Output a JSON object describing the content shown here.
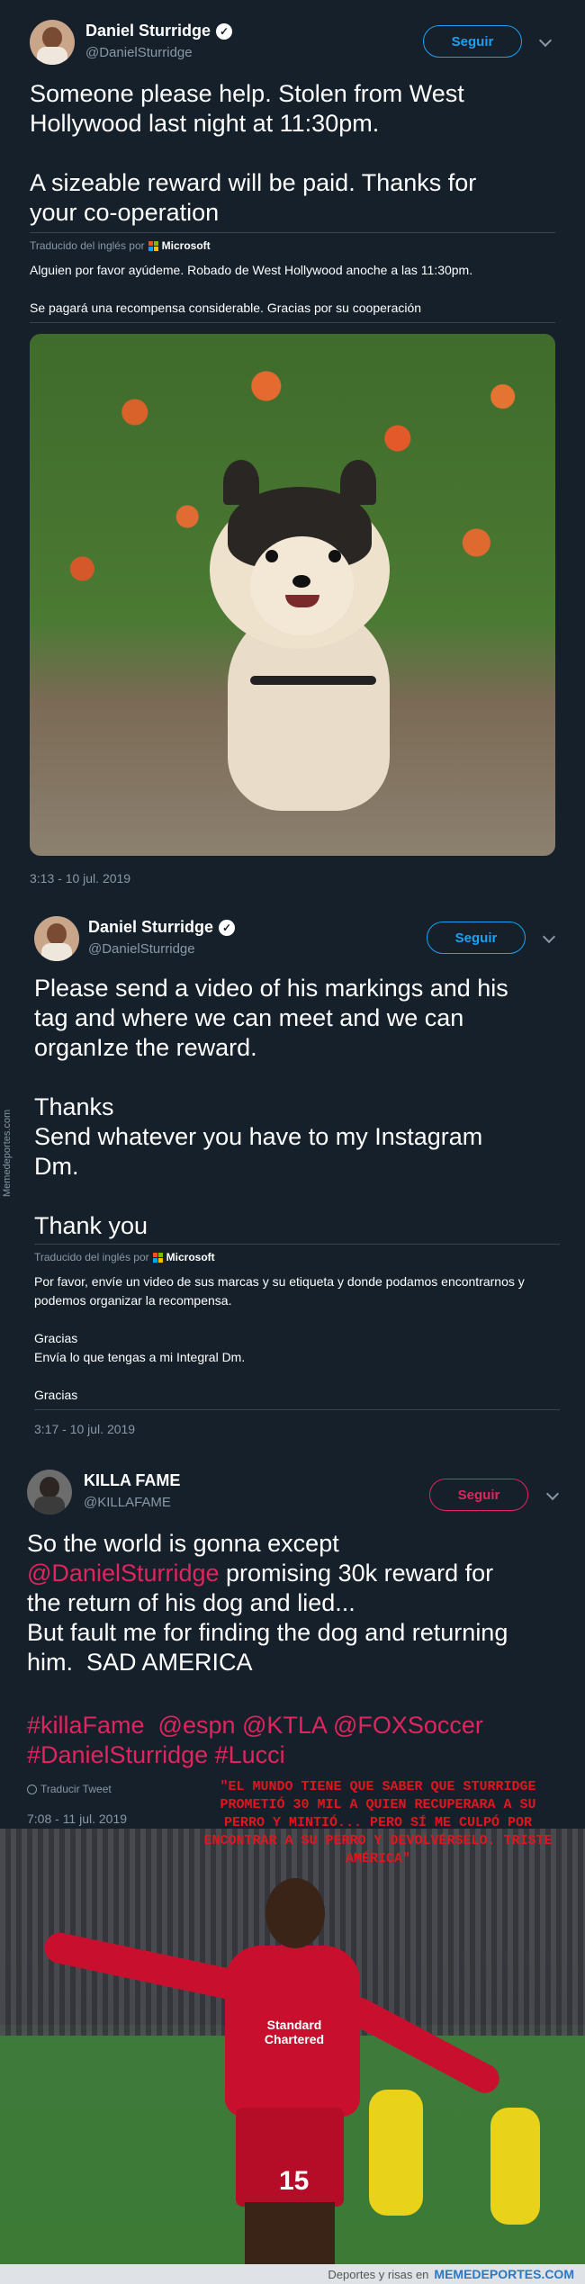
{
  "tweet1": {
    "name": "Daniel Sturridge",
    "verified_mark": "✓",
    "handle": "@DanielSturridge",
    "follow_label": "Seguir",
    "text": "Someone please help. Stolen from West\nHollywood last night at 11:30pm.\n\nA sizeable reward will be paid. Thanks for\nyour co-operation",
    "translated_by": "Traducido del inglés por",
    "translator": "Microsoft",
    "translation": "Alguien por favor ayúdeme. Robado de West Hollywood anoche a las 11:30pm.\n\nSe pagará una recompensa considerable. Gracias por su cooperación",
    "timestamp": "3:13 - 10 jul. 2019"
  },
  "tweet2": {
    "name": "Daniel Sturridge",
    "verified_mark": "✓",
    "handle": "@DanielSturridge",
    "follow_label": "Seguir",
    "text": "Please send a video of his markings and his\ntag and where we can meet and we can\norganIze the reward.\n\nThanks\nSend whatever you have to my Instagram\nDm.\n\nThank you",
    "translated_by": "Traducido del inglés por",
    "translator": "Microsoft",
    "translation": "Por favor, envíe un video de sus marcas y su etiqueta y donde podamos encontrarnos y\npodemos organizar la recompensa.\n\nGracias\nEnvía lo que tengas a mi Integral Dm.\n\nGracias",
    "timestamp": "3:17 - 10 jul. 2019"
  },
  "tweet3": {
    "name": "KILLA FAME",
    "handle": "@KILLAFAME",
    "follow_label": "Seguir",
    "text_a": "So the world is gonna except",
    "mention": "@DanielSturridge",
    "text_b": " promising 30k reward for\nthe return of his dog and lied...\nBut fault me for finding the dog and returning\nhim.  SAD AMERICA",
    "hashtags": "#killaFame  @espn @KTLA @FOXSoccer\n#DanielSturridge #Lucci",
    "translate_label": "Traducir Tweet",
    "timestamp": "7:08 - 11 jul. 2019"
  },
  "sidebar_watermark": "Memedeportes.com",
  "caption": "\"El mundo tiene que saber que Sturridge\nprometió 30 mil a quien recuperara a su\nperro y mintió... pero sí me culpó por\nencontrar a su perro y devolvérselo. Triste\nAmérica\"",
  "photo2": {
    "sponsor": "Standard\nChartered",
    "number": "15"
  },
  "footer": {
    "tagline": "Deportes y risas en",
    "brand": "MEMEDEPORTES.COM"
  },
  "colors": {
    "background": "#15202b",
    "accent": "#1da1f2",
    "mention": "#e0245e",
    "caption": "#e0161f"
  },
  "icons": {
    "ms_logo": "microsoft-logo",
    "globe": "globe-icon",
    "chevron": "chevron-down-icon"
  }
}
